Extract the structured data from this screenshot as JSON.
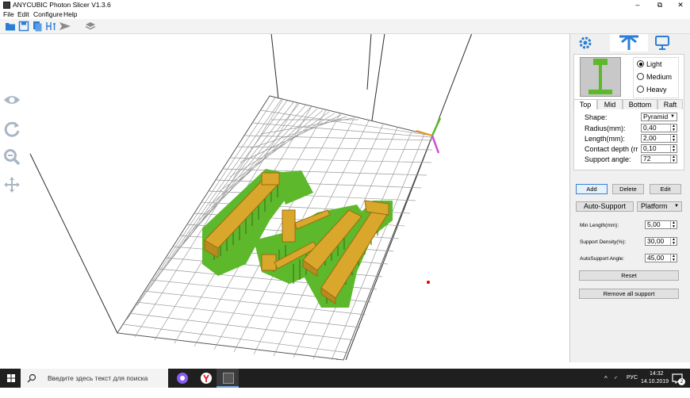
{
  "app": {
    "title": "ANYCUBIC Photon Slicer V1.3.6",
    "window_controls": [
      "–",
      "⧉",
      "✕"
    ]
  },
  "menu": [
    "File",
    "Edit",
    "Configure",
    "Help"
  ],
  "toolbar": {
    "icons": [
      "open-folder-icon",
      "save-icon",
      "copy-icon",
      "support-icon",
      "slice-arrow-icon",
      "layers-icon"
    ]
  },
  "viewport": {
    "side_tools": [
      "eye-icon",
      "rotate-icon",
      "zoom-icon",
      "move-icon"
    ]
  },
  "panel": {
    "tabs": [
      "settings-gear-icon",
      "support-icon",
      "monitor-icon"
    ],
    "density": {
      "options": [
        "Light",
        "Medium",
        "Heavy"
      ],
      "selected": "Light"
    },
    "subtabs": [
      "Top",
      "Mid",
      "Bottom",
      "Raft"
    ],
    "active_subtab": "Top",
    "params": {
      "shape_label": "Shape:",
      "shape_value": "Pyramid",
      "radius_label": "Radius(mm):",
      "radius_value": "0,40",
      "length_label": "Length(mm):",
      "length_value": "2,00",
      "depth_label": "Contact depth (rr",
      "depth_value": "0,10",
      "angle_label": "Support angle:",
      "angle_value": "72"
    },
    "actions": {
      "add": "Add",
      "delete": "Delete",
      "edit": "Edit"
    },
    "auto_support": "Auto-Support",
    "auto_mode": "Platform",
    "auto": {
      "min_length_label": "Min Length(mm):",
      "min_length_value": "5,00",
      "density_label": "Support Density(%):",
      "density_value": "30,00",
      "angle_label": "AutoSupport Angle:",
      "angle_value": "45,00"
    },
    "reset": "Reset",
    "remove_all": "Remove all support"
  },
  "taskbar": {
    "search_placeholder": "Введите здесь текст для поиска",
    "language": "РУС",
    "time": "14:32",
    "date": "14.10.2019",
    "notifications": "2"
  },
  "colors": {
    "model": "#d9a72b",
    "supports": "#5db82b",
    "platform_grid": "#9a9a9a",
    "panel_bg": "#f0f0f0",
    "accent": "#2a7ed6"
  }
}
